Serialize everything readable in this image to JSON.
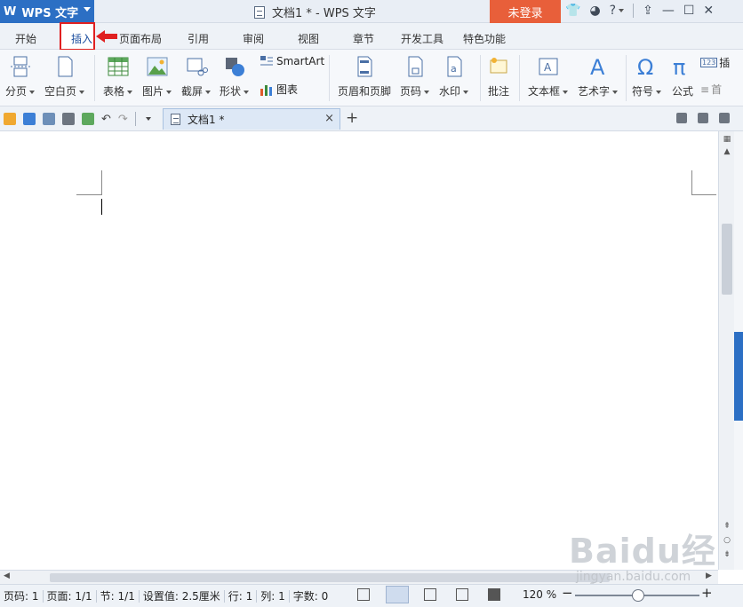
{
  "titlebar": {
    "app_name": "WPS 文字",
    "window_title": "文档1 * - WPS 文字",
    "login_label": "未登录",
    "help_label": "?"
  },
  "tabs": [
    {
      "label": "开始"
    },
    {
      "label": "插入"
    },
    {
      "label": "页面布局"
    },
    {
      "label": "引用"
    },
    {
      "label": "审阅"
    },
    {
      "label": "视图"
    },
    {
      "label": "章节"
    },
    {
      "label": "开发工具"
    },
    {
      "label": "特色功能"
    }
  ],
  "ribbon": {
    "page_break": "分页",
    "blank_page": "空白页",
    "table": "表格",
    "picture": "图片",
    "screenshot": "截屏",
    "shapes": "形状",
    "smartart": "SmartArt",
    "chart": "图表",
    "header_footer": "页眉和页脚",
    "page_number": "页码",
    "watermark": "水印",
    "comment": "批注",
    "textbox": "文本框",
    "wordart": "艺术字",
    "symbol": "符号",
    "formula": "公式",
    "insert_num": "插",
    "first": "首"
  },
  "doc_tab": {
    "label": "文档1 *",
    "close": "×",
    "new": "+"
  },
  "status": {
    "page_code": "页码: 1",
    "page": "页面: 1/1",
    "section": "节: 1/1",
    "setting": "设置值: 2.5厘米",
    "row": "行: 1",
    "col": "列: 1",
    "words": "字数: 0",
    "zoom": "120 %"
  },
  "watermark": {
    "text": "Baidu经验",
    "url": "jingyan.baidu.com"
  },
  "colors": {
    "accent": "#2c6fc4",
    "login": "#e85f3a",
    "highlight": "#e02020"
  }
}
